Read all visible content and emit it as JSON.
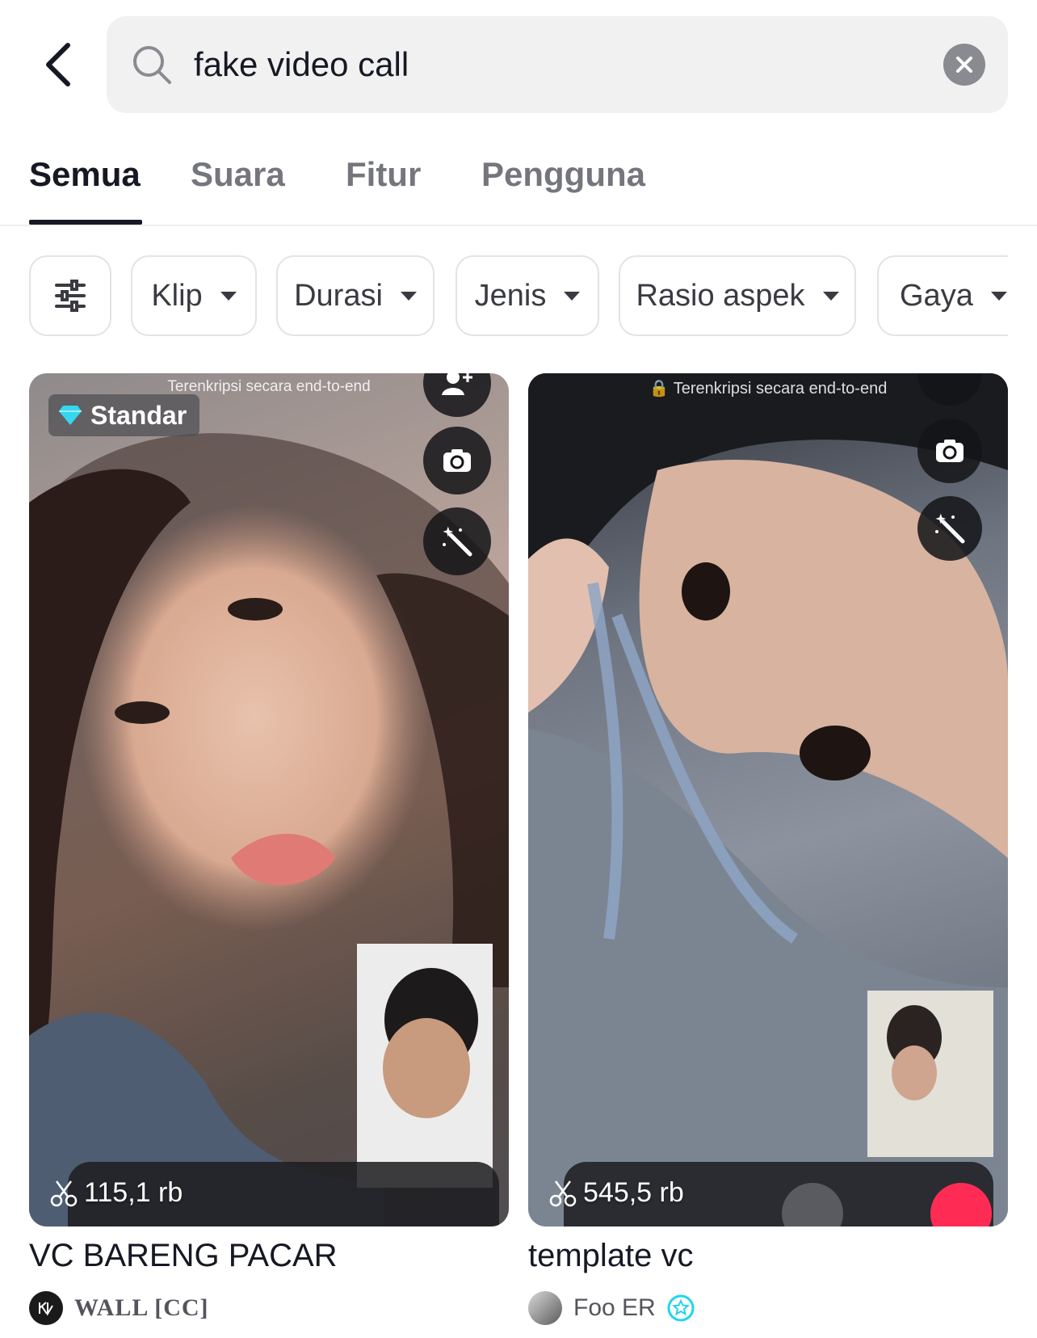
{
  "header": {
    "search_value": "fake video call",
    "back_icon": "chevron-left-icon",
    "search_icon": "search-icon",
    "clear_icon": "close-icon"
  },
  "tabs": [
    {
      "label": "Semua",
      "active": true
    },
    {
      "label": "Suara",
      "active": false
    },
    {
      "label": "Fitur",
      "active": false
    },
    {
      "label": "Pengguna",
      "active": false
    }
  ],
  "filters": {
    "settings_icon": "sliders-icon",
    "chips": [
      "Klip",
      "Durasi",
      "Jenis",
      "Rasio aspek",
      "Gaya"
    ]
  },
  "results": [
    {
      "encryption_text": "Terenkripsi secara end-to-end",
      "badge": "Standar",
      "count": "115,1 rb",
      "title": "VC BARENG PACAR",
      "author": "WALL [CC]",
      "verified": false
    },
    {
      "encryption_text": "Terenkripsi secara end-to-end",
      "count": "545,5 rb",
      "title": "template vc",
      "author": "Foo ER",
      "verified": true
    }
  ],
  "colors": {
    "text_primary": "#161823",
    "text_secondary": "#75767d",
    "chip_border": "#e3e3e4",
    "search_bg": "#f1f1f2",
    "badge_diamond": "#34d7f0",
    "verified": "#20d5ec",
    "end_call": "#fe2c55"
  }
}
